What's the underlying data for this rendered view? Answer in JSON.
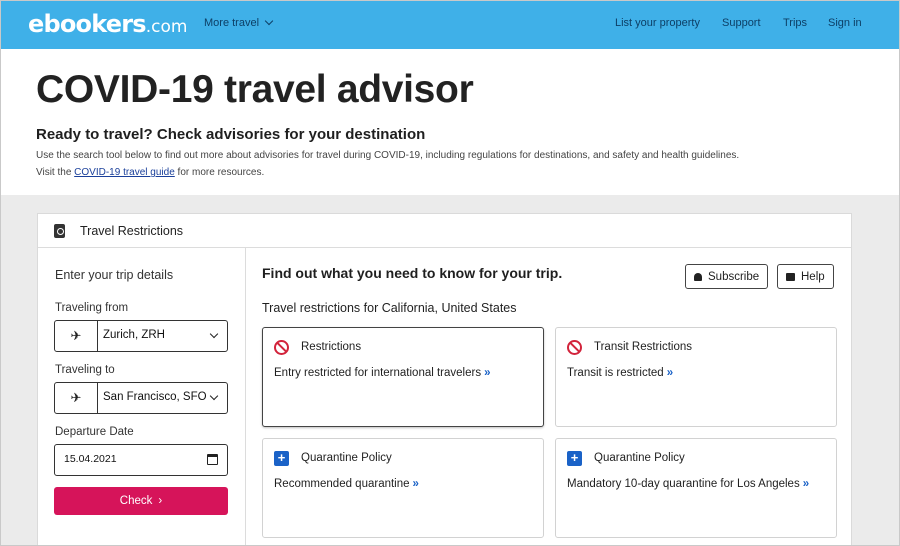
{
  "header": {
    "logo_main": "ebookers",
    "logo_domain": ".com",
    "nav_more": "More travel",
    "nav_items": [
      "List your property",
      "Support",
      "Trips",
      "Sign in"
    ]
  },
  "intro": {
    "title": "COVID-19 travel advisor",
    "subtitle": "Ready to travel? Check advisories for your destination",
    "line1": "Use the search tool below to find out more about advisories for travel during COVID-19, including regulations for destinations, and safety and health guidelines.",
    "line2_pre": "Visit the ",
    "line2_link": "COVID-19 travel guide",
    "line2_post": " for more resources."
  },
  "card": {
    "title": "Travel Restrictions",
    "form": {
      "heading": "Enter your trip details",
      "from_label": "Traveling from",
      "from_value": "Zurich, ZRH",
      "to_label": "Traveling to",
      "to_value": "San Francisco, SFO",
      "date_label": "Departure Date",
      "date_value": "15.04.2021",
      "check_label": "Check"
    },
    "results": {
      "heading": "Find out what you need to know for your trip.",
      "subscribe_label": "Subscribe",
      "help_label": "Help",
      "restrictions_title": "Travel restrictions for California, United States",
      "tiles": [
        {
          "name": "Restrictions",
          "desc": "Entry restricted for international travelers",
          "icon": "no-entry-icon"
        },
        {
          "name": "Transit Restrictions",
          "desc": "Transit is restricted",
          "icon": "no-entry-icon"
        },
        {
          "name": "Quarantine Policy",
          "desc": "Recommended quarantine",
          "icon": "plus-box-icon"
        },
        {
          "name": "Quarantine Policy",
          "desc": "Mandatory 10-day quarantine for Los Angeles",
          "icon": "plus-box-icon"
        }
      ]
    }
  },
  "colors": {
    "header_bg": "#3fb0e8",
    "check_button": "#d6145a",
    "link_blue": "#1a62c7",
    "restriction_red": "#d2233b"
  }
}
